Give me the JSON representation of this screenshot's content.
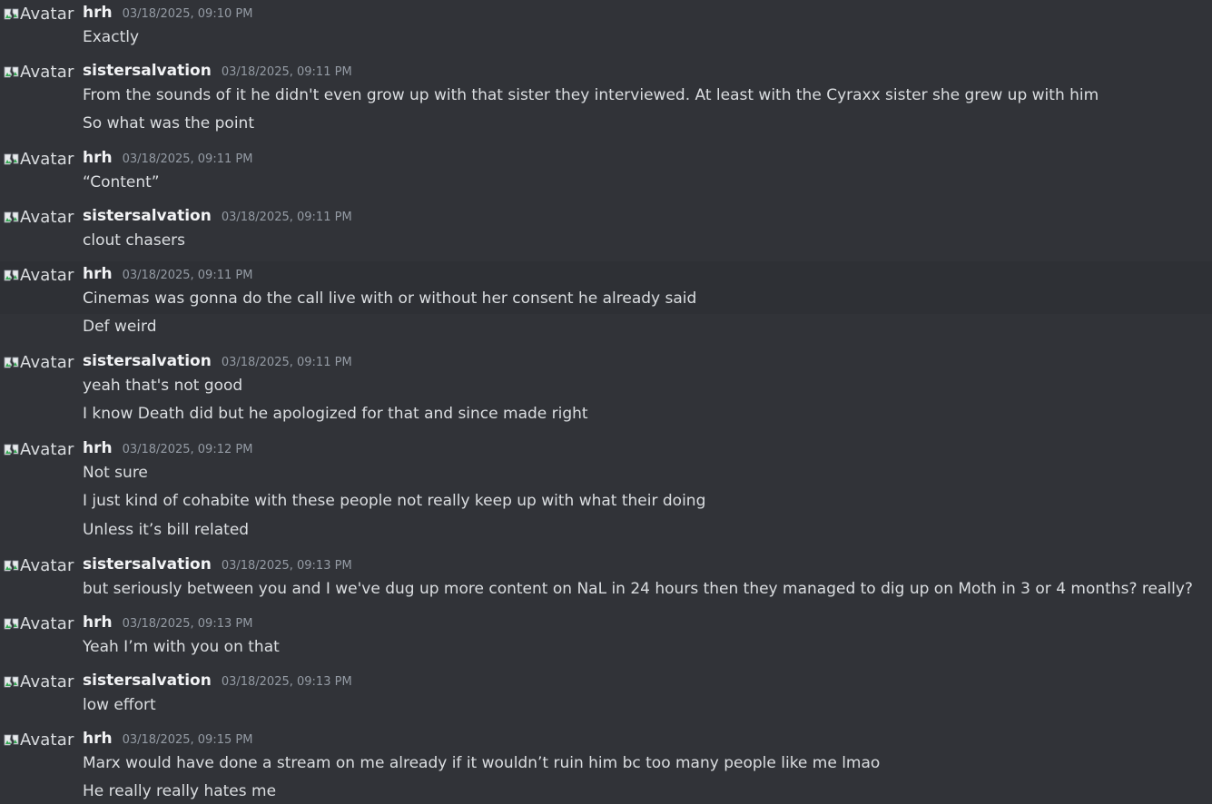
{
  "avatar_alt": "Avatar",
  "messages": [
    {
      "user": "hrh",
      "time": "03/18/2025, 09:10 PM",
      "lines": [
        "Exactly"
      ]
    },
    {
      "user": "sistersalvation",
      "time": "03/18/2025, 09:11 PM",
      "lines": [
        "From the sounds of it he didn't even grow up with that sister they interviewed. At least with the Cyraxx sister she grew up with him",
        "So what was the point"
      ]
    },
    {
      "user": "hrh",
      "time": "03/18/2025, 09:11 PM",
      "lines": [
        "“Content”"
      ]
    },
    {
      "user": "sistersalvation",
      "time": "03/18/2025, 09:11 PM",
      "lines": [
        "clout chasers"
      ]
    },
    {
      "user": "hrh",
      "time": "03/18/2025, 09:11 PM",
      "lines": [
        "Cinemas was gonna do the call live with or without her consent he already said",
        "Def weird"
      ]
    },
    {
      "user": "sistersalvation",
      "time": "03/18/2025, 09:11 PM",
      "lines": [
        "yeah that's not good",
        "I know Death did but he apologized for that and since made right"
      ]
    },
    {
      "user": "hrh",
      "time": "03/18/2025, 09:12 PM",
      "lines": [
        "Not sure",
        "I just kind of cohabite with these people not really keep up with what their doing",
        "Unless it’s bill related"
      ]
    },
    {
      "user": "sistersalvation",
      "time": "03/18/2025, 09:13 PM",
      "lines": [
        "but seriously between you and I we've dug up more content on NaL in 24 hours then they managed to dig up on Moth in 3 or 4 months? really?"
      ]
    },
    {
      "user": "hrh",
      "time": "03/18/2025, 09:13 PM",
      "lines": [
        "Yeah I’m with you on that"
      ]
    },
    {
      "user": "sistersalvation",
      "time": "03/18/2025, 09:13 PM",
      "lines": [
        "low effort"
      ]
    },
    {
      "user": "hrh",
      "time": "03/18/2025, 09:15 PM",
      "lines": [
        "Marx would have done a stream on me already if it wouldn’t ruin him bc too many people like me lmao",
        "He really really hates me"
      ]
    }
  ]
}
